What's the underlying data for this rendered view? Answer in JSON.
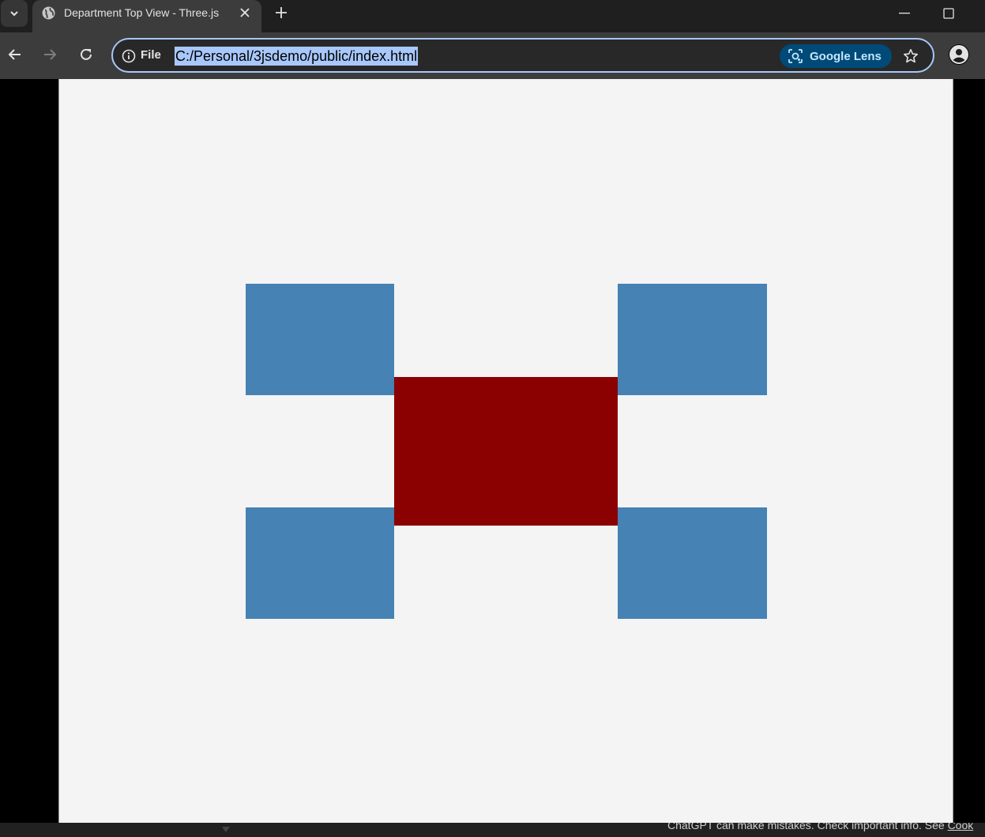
{
  "browser": {
    "tab": {
      "title": "Department Top View - Three.js"
    },
    "omnibox": {
      "security_label": "File",
      "url": "C:/Personal/3jsdemo/public/index.html",
      "lens_label": "Google Lens"
    }
  },
  "scene": {
    "background_color": "#f4f4f4",
    "center_room_color": "#8b0000",
    "corner_room_color": "#4682b4"
  },
  "footer": {
    "note": "ChatGPT can make mistakes. Check important info. See ",
    "link": "Cook"
  },
  "icons": {
    "tab_search": "chevron-down-icon",
    "tab_favicon": "globe-icon",
    "tab_close": "close-icon",
    "new_tab": "plus-icon",
    "back": "arrow-left-icon",
    "forward": "arrow-right-icon",
    "reload": "reload-icon",
    "site_info": "info-icon",
    "lens": "lens-icon",
    "bookmark": "star-icon",
    "profile": "person-icon"
  }
}
